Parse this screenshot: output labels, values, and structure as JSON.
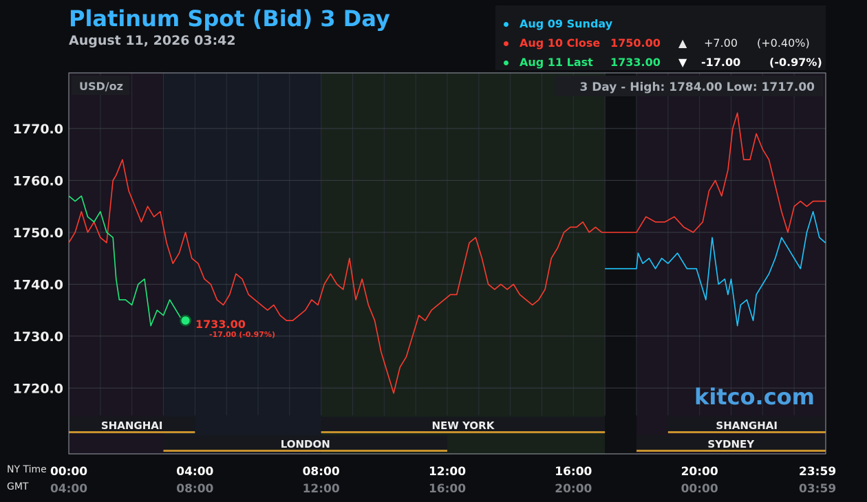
{
  "header": {
    "title": "Platinum Spot (Bid) 3 Day",
    "subtitle": "August 11, 2026 03:42"
  },
  "legend": [
    {
      "label": "Aug 09 Sunday",
      "price": "",
      "arrow": "",
      "change": "",
      "pct": "",
      "color": "#1fc8ff"
    },
    {
      "label": "Aug 10 Close",
      "price": "1750.00",
      "arrow": "▲",
      "change": "+7.00",
      "pct": "(+0.40%)",
      "color": "#ff3b2f"
    },
    {
      "label": "Aug 11 Last",
      "price": "1733.00",
      "arrow": "▼",
      "change": "-17.00",
      "pct": "(-0.97%)",
      "color": "#22e879"
    }
  ],
  "chart_data": {
    "type": "line",
    "unit_label": "USD/oz",
    "range_text": "3 Day - High: 1784.00  Low: 1717.00",
    "ylim": [
      1715,
      1780
    ],
    "y_ticks": [
      1720,
      1730,
      1740,
      1750,
      1760,
      1770
    ],
    "y_tick_labels": [
      "1720.0",
      "1730.0",
      "1740.0",
      "1750.0",
      "1760.0",
      "1770.0"
    ],
    "xlim": [
      0,
      24
    ],
    "x_ticks": [
      0,
      4,
      8,
      12,
      16,
      20,
      24
    ],
    "x_labels_ny": [
      "00:00",
      "04:00",
      "08:00",
      "12:00",
      "16:00",
      "20:00",
      "23:59"
    ],
    "x_labels_gmt": [
      "04:00",
      "08:00",
      "12:00",
      "16:00",
      "20:00",
      "00:00",
      "03:59"
    ],
    "grid": true,
    "series": [
      {
        "name": "Aug 09 Sunday",
        "color": "#1fc8ff",
        "x": [
          17.0,
          18.0,
          18.05,
          18.2,
          18.4,
          18.6,
          18.8,
          19.0,
          19.3,
          19.6,
          19.9,
          20.2,
          20.4,
          20.6,
          20.8,
          20.9,
          21.0,
          21.2,
          21.3,
          21.5,
          21.7,
          21.8,
          22.0,
          22.2,
          22.4,
          22.6,
          22.8,
          23.0,
          23.2,
          23.4,
          23.6,
          23.8,
          23.99
        ],
        "values": [
          1743,
          1743,
          1746,
          1744,
          1745,
          1743,
          1745,
          1744,
          1746,
          1743,
          1743,
          1737,
          1749,
          1740,
          1741,
          1738,
          1741,
          1732,
          1736,
          1737,
          1733,
          1738,
          1740,
          1742,
          1745,
          1749,
          1747,
          1745,
          1743,
          1750,
          1754,
          1749,
          1748
        ]
      },
      {
        "name": "Aug 10 Close",
        "color": "#ff3b2f",
        "x": [
          0.0,
          0.2,
          0.4,
          0.6,
          0.8,
          1.0,
          1.2,
          1.4,
          1.5,
          1.7,
          1.9,
          2.1,
          2.3,
          2.5,
          2.7,
          2.9,
          3.1,
          3.3,
          3.5,
          3.7,
          3.9,
          4.1,
          4.3,
          4.5,
          4.7,
          4.9,
          5.1,
          5.3,
          5.5,
          5.7,
          5.9,
          6.1,
          6.3,
          6.5,
          6.7,
          6.9,
          7.1,
          7.3,
          7.5,
          7.7,
          7.9,
          8.1,
          8.3,
          8.5,
          8.7,
          8.9,
          9.1,
          9.3,
          9.5,
          9.7,
          9.9,
          10.1,
          10.3,
          10.5,
          10.7,
          10.9,
          11.1,
          11.3,
          11.5,
          11.7,
          11.9,
          12.1,
          12.3,
          12.5,
          12.7,
          12.9,
          13.1,
          13.3,
          13.5,
          13.7,
          13.9,
          14.1,
          14.3,
          14.5,
          14.7,
          14.9,
          15.1,
          15.3,
          15.5,
          15.7,
          15.9,
          16.1,
          16.3,
          16.5,
          16.7,
          16.9,
          17.0,
          18.0,
          18.3,
          18.6,
          18.9,
          19.2,
          19.5,
          19.8,
          20.1,
          20.3,
          20.5,
          20.7,
          20.9,
          21.05,
          21.2,
          21.4,
          21.6,
          21.8,
          22.0,
          22.2,
          22.4,
          22.6,
          22.8,
          23.0,
          23.2,
          23.4,
          23.6,
          23.99
        ],
        "values": [
          1748,
          1750,
          1754,
          1750,
          1752,
          1749,
          1748,
          1760,
          1761,
          1764,
          1758,
          1755,
          1752,
          1755,
          1753,
          1754,
          1748,
          1744,
          1746,
          1750,
          1745,
          1744,
          1741,
          1740,
          1737,
          1736,
          1738,
          1742,
          1741,
          1738,
          1737,
          1736,
          1735,
          1736,
          1734,
          1733,
          1733,
          1734,
          1735,
          1737,
          1736,
          1740,
          1742,
          1740,
          1739,
          1745,
          1737,
          1741,
          1736,
          1733,
          1727,
          1723,
          1719,
          1724,
          1726,
          1730,
          1734,
          1733,
          1735,
          1736,
          1737,
          1738,
          1738,
          1743,
          1748,
          1749,
          1745,
          1740,
          1739,
          1740,
          1739,
          1740,
          1738,
          1737,
          1736,
          1737,
          1739,
          1745,
          1747,
          1750,
          1751,
          1751,
          1752,
          1750,
          1751,
          1750,
          1750,
          1750,
          1753,
          1752,
          1752,
          1753,
          1751,
          1750,
          1752,
          1758,
          1760,
          1757,
          1762,
          1770,
          1773,
          1764,
          1764,
          1769,
          1766,
          1764,
          1759,
          1754,
          1750,
          1755,
          1756,
          1755,
          1756,
          1756
        ]
      },
      {
        "name": "Aug 11 Last",
        "color": "#22e879",
        "x": [
          0.0,
          0.2,
          0.4,
          0.6,
          0.8,
          1.0,
          1.2,
          1.4,
          1.5,
          1.6,
          1.8,
          2.0,
          2.2,
          2.4,
          2.6,
          2.8,
          3.0,
          3.2,
          3.4,
          3.6,
          3.7
        ],
        "values": [
          1757,
          1756,
          1757,
          1753,
          1752,
          1754,
          1750,
          1749,
          1741,
          1737,
          1737,
          1736,
          1740,
          1741,
          1732,
          1735,
          1734,
          1737,
          1735,
          1733,
          1733
        ]
      }
    ],
    "last_point": {
      "x": 3.7,
      "value": 1733,
      "label": "1733.00",
      "sub_label": "-17.00 (-0.97%)",
      "color": "#22e879"
    },
    "sessions": [
      {
        "name": "SHANGHAI",
        "row": "top",
        "start": 0,
        "end": 4
      },
      {
        "name": "NEW YORK",
        "row": "top",
        "start": 8,
        "end": 17
      },
      {
        "name": "SHANGHAI",
        "row": "top",
        "start": 19,
        "end": 23.99
      },
      {
        "name": "LONDON",
        "row": "bottom",
        "start": 3,
        "end": 12
      },
      {
        "name": "SYDNEY",
        "row": "bottom",
        "start": 18,
        "end": 23.99
      }
    ],
    "session_bg": [
      {
        "start": 0,
        "end": 3,
        "color": "#1a1520"
      },
      {
        "start": 3,
        "end": 8,
        "color": "#151a24"
      },
      {
        "start": 8,
        "end": 17,
        "color": "#18221b"
      },
      {
        "start": 17,
        "end": 18,
        "color": "#0e0f12"
      },
      {
        "start": 18,
        "end": 23.99,
        "color": "#1a1520"
      }
    ],
    "watermark": "kitco.com"
  },
  "footer": {
    "ny_label": "NY Time",
    "gmt_label": "GMT"
  }
}
